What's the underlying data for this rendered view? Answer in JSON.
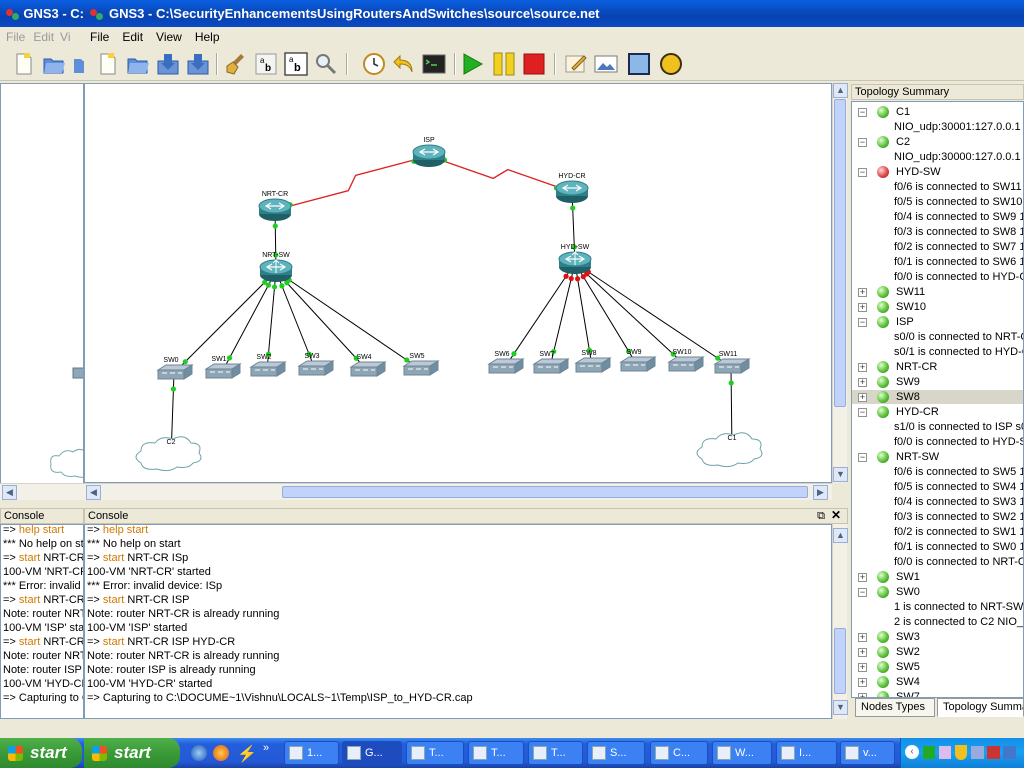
{
  "window_back": {
    "title": "GNS3 - C:",
    "menu": [
      "File",
      "Edit",
      "Vi"
    ]
  },
  "window_front": {
    "title": "GNS3 - C:\\SecurityEnhancementsUsingRoutersAndSwitches\\source\\source.net",
    "menu": [
      "File",
      "Edit",
      "View",
      "Help"
    ]
  },
  "topology": {
    "nodes": [
      {
        "id": "ISP",
        "label": "ISP",
        "kind": "router"
      },
      {
        "id": "NRT-CR",
        "label": "NRT-CR",
        "kind": "router"
      },
      {
        "id": "HYD-CR",
        "label": "HYD-CR",
        "kind": "router"
      },
      {
        "id": "NRT-SW",
        "label": "NRT-SW",
        "kind": "ethsw"
      },
      {
        "id": "HYD-SW",
        "label": "HYD-SW",
        "kind": "ethsw"
      },
      {
        "id": "SW0",
        "label": "SW0",
        "kind": "switch"
      },
      {
        "id": "SW1",
        "label": "SW1",
        "kind": "switch"
      },
      {
        "id": "SW2",
        "label": "SW2",
        "kind": "switch"
      },
      {
        "id": "SW3",
        "label": "SW3",
        "kind": "switch"
      },
      {
        "id": "SW4",
        "label": "SW4",
        "kind": "switch"
      },
      {
        "id": "SW5",
        "label": "SW5",
        "kind": "switch"
      },
      {
        "id": "SW6",
        "label": "SW6",
        "kind": "switch"
      },
      {
        "id": "SW7",
        "label": "SW7",
        "kind": "switch"
      },
      {
        "id": "SW8",
        "label": "SW8",
        "kind": "switch"
      },
      {
        "id": "SW9",
        "label": "SW9",
        "kind": "switch"
      },
      {
        "id": "SW10",
        "label": "SW10",
        "kind": "switch"
      },
      {
        "id": "SW11",
        "label": "SW11",
        "kind": "switch"
      },
      {
        "id": "C2",
        "label": "C2",
        "kind": "cloud"
      },
      {
        "id": "C1",
        "label": "C1",
        "kind": "cloud"
      }
    ],
    "links": [
      {
        "a": "ISP",
        "b": "NRT-CR",
        "type": "serial"
      },
      {
        "a": "ISP",
        "b": "HYD-CR",
        "type": "serial"
      },
      {
        "a": "NRT-CR",
        "b": "NRT-SW",
        "type": "ethernet"
      },
      {
        "a": "HYD-CR",
        "b": "HYD-SW",
        "type": "ethernet"
      },
      {
        "a": "NRT-SW",
        "b": "SW0",
        "type": "ethernet"
      },
      {
        "a": "NRT-SW",
        "b": "SW1",
        "type": "ethernet"
      },
      {
        "a": "NRT-SW",
        "b": "SW2",
        "type": "ethernet"
      },
      {
        "a": "NRT-SW",
        "b": "SW3",
        "type": "ethernet"
      },
      {
        "a": "NRT-SW",
        "b": "SW4",
        "type": "ethernet"
      },
      {
        "a": "NRT-SW",
        "b": "SW5",
        "type": "ethernet"
      },
      {
        "a": "HYD-SW",
        "b": "SW6",
        "type": "ethernet"
      },
      {
        "a": "HYD-SW",
        "b": "SW7",
        "type": "ethernet"
      },
      {
        "a": "HYD-SW",
        "b": "SW8",
        "type": "ethernet"
      },
      {
        "a": "HYD-SW",
        "b": "SW9",
        "type": "ethernet"
      },
      {
        "a": "HYD-SW",
        "b": "SW10",
        "type": "ethernet"
      },
      {
        "a": "HYD-SW",
        "b": "SW11",
        "type": "ethernet"
      },
      {
        "a": "SW0",
        "b": "C2",
        "type": "ethernet"
      },
      {
        "a": "SW11",
        "b": "C1",
        "type": "ethernet"
      }
    ]
  },
  "console": {
    "title": "Console",
    "lines": [
      {
        "prompt": "=> ",
        "cmd": "help start",
        "rest": ""
      },
      {
        "prompt": "",
        "cmd": "",
        "rest": "*** No help on start"
      },
      {
        "prompt": "=> ",
        "cmd": "start",
        "rest": " NRT-CR ISp"
      },
      {
        "prompt": "",
        "cmd": "",
        "rest": "100-VM 'NRT-CR' started"
      },
      {
        "prompt": "",
        "cmd": "",
        "rest": "*** Error: invalid device: ISp"
      },
      {
        "prompt": "=> ",
        "cmd": "start",
        "rest": " NRT-CR ISP"
      },
      {
        "prompt": "",
        "cmd": "",
        "rest": "Note: router NRT-CR is already running"
      },
      {
        "prompt": "",
        "cmd": "",
        "rest": "100-VM 'ISP' started"
      },
      {
        "prompt": "=> ",
        "cmd": "start",
        "rest": " NRT-CR ISP HYD-CR"
      },
      {
        "prompt": "",
        "cmd": "",
        "rest": "Note: router NRT-CR is already running"
      },
      {
        "prompt": "",
        "cmd": "",
        "rest": "Note: router ISP is already running"
      },
      {
        "prompt": "",
        "cmd": "",
        "rest": "100-VM 'HYD-CR' started"
      },
      {
        "prompt": "",
        "cmd": "",
        "rest": "=> Capturing to C:\\DOCUME~1\\Vishnu\\LOCALS~1\\Temp\\ISP_to_HYD-CR.cap"
      }
    ]
  },
  "topology_summary": {
    "title": "Topology Summary",
    "rows": [
      {
        "level": 0,
        "exp": "−",
        "led": "green",
        "text": "C1"
      },
      {
        "level": 1,
        "text": "NIO_udp:30001:127.0.0.1"
      },
      {
        "level": 0,
        "exp": "−",
        "led": "green",
        "text": "C2"
      },
      {
        "level": 1,
        "text": "NIO_udp:30000:127.0.0.1"
      },
      {
        "level": 0,
        "exp": "−",
        "led": "red",
        "text": "HYD-SW"
      },
      {
        "level": 1,
        "text": "f0/6 is connected to SW11"
      },
      {
        "level": 1,
        "text": "f0/5 is connected to SW10"
      },
      {
        "level": 1,
        "text": "f0/4 is connected to SW9 1"
      },
      {
        "level": 1,
        "text": "f0/3 is connected to SW8 1"
      },
      {
        "level": 1,
        "text": "f0/2 is connected to SW7 1"
      },
      {
        "level": 1,
        "text": "f0/1 is connected to SW6 1"
      },
      {
        "level": 1,
        "text": "f0/0 is connected to HYD-C"
      },
      {
        "level": 0,
        "exp": "+",
        "led": "green",
        "text": "SW11"
      },
      {
        "level": 0,
        "exp": "+",
        "led": "green",
        "text": "SW10"
      },
      {
        "level": 0,
        "exp": "−",
        "led": "green",
        "text": "ISP"
      },
      {
        "level": 1,
        "text": "s0/0 is connected to NRT-C"
      },
      {
        "level": 1,
        "text": "s0/1 is connected to HYD-C"
      },
      {
        "level": 0,
        "exp": "+",
        "led": "green",
        "text": "NRT-CR"
      },
      {
        "level": 0,
        "exp": "+",
        "led": "green",
        "text": "SW9"
      },
      {
        "level": 0,
        "exp": "+",
        "led": "green",
        "text": "SW8",
        "selected": true
      },
      {
        "level": 0,
        "exp": "−",
        "led": "green",
        "text": "HYD-CR"
      },
      {
        "level": 1,
        "text": "s1/0 is connected to ISP s0"
      },
      {
        "level": 1,
        "text": "f0/0 is connected to HYD-S"
      },
      {
        "level": 0,
        "exp": "−",
        "led": "green",
        "text": "NRT-SW"
      },
      {
        "level": 1,
        "text": "f0/6 is connected to SW5 1"
      },
      {
        "level": 1,
        "text": "f0/5 is connected to SW4 1"
      },
      {
        "level": 1,
        "text": "f0/4 is connected to SW3 1"
      },
      {
        "level": 1,
        "text": "f0/3 is connected to SW2 1"
      },
      {
        "level": 1,
        "text": "f0/2 is connected to SW1 1"
      },
      {
        "level": 1,
        "text": "f0/1 is connected to SW0 1"
      },
      {
        "level": 1,
        "text": "f0/0 is connected to NRT-C"
      },
      {
        "level": 0,
        "exp": "+",
        "led": "green",
        "text": "SW1"
      },
      {
        "level": 0,
        "exp": "−",
        "led": "green",
        "text": "SW0"
      },
      {
        "level": 1,
        "text": "1 is connected to NRT-SW f"
      },
      {
        "level": 1,
        "text": "2 is connected to C2 NIO_u"
      },
      {
        "level": 0,
        "exp": "+",
        "led": "green",
        "text": "SW3"
      },
      {
        "level": 0,
        "exp": "+",
        "led": "green",
        "text": "SW2"
      },
      {
        "level": 0,
        "exp": "+",
        "led": "green",
        "text": "SW5"
      },
      {
        "level": 0,
        "exp": "+",
        "led": "green",
        "text": "SW4"
      },
      {
        "level": 0,
        "exp": "+",
        "led": "green",
        "text": "SW7"
      }
    ],
    "tabs": [
      "Nodes Types",
      "Topology Summary"
    ]
  },
  "taskbar": {
    "start_label": "start",
    "tasks": [
      "1...",
      "G...",
      "T...",
      "T...",
      "T...",
      "S...",
      "C...",
      "W...",
      "I...",
      "v..."
    ]
  },
  "colors": {
    "serial_link": "#e02020",
    "ethernet_link": "#000000",
    "port_up": "#22cc22",
    "port_down": "#dd1111"
  }
}
